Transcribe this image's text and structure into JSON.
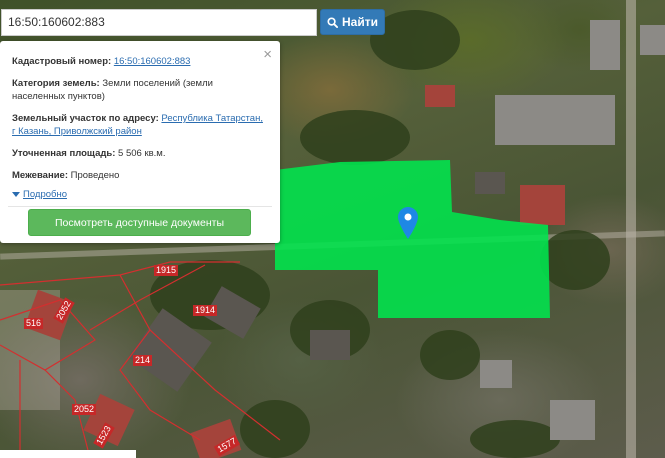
{
  "search": {
    "value": "16:50:160602:883",
    "button_label": "Найти"
  },
  "card": {
    "cadastral_label": "Кадастровый номер:",
    "cadastral_value": "16:50:160602:883",
    "category_label": "Категория земель:",
    "category_value": "Земли поселений (земли населенных пунктов)",
    "address_label": "Земельный участок по адресу:",
    "address_value": "Республика Татарстан, г Казань, Приволжский район",
    "area_label": "Уточненная площадь:",
    "area_value": "5 506 кв.м.",
    "survey_label": "Межевание:",
    "survey_value": "Проведено",
    "more_label": "Подробно",
    "docs_button": "Посмотреть доступные документы",
    "close_symbol": "×"
  },
  "map": {
    "parcel_labels": [
      "1915",
      "1914",
      "516",
      "2052",
      "214",
      "2052",
      "1523",
      "1577"
    ],
    "highlight_color": "#00e64d"
  }
}
